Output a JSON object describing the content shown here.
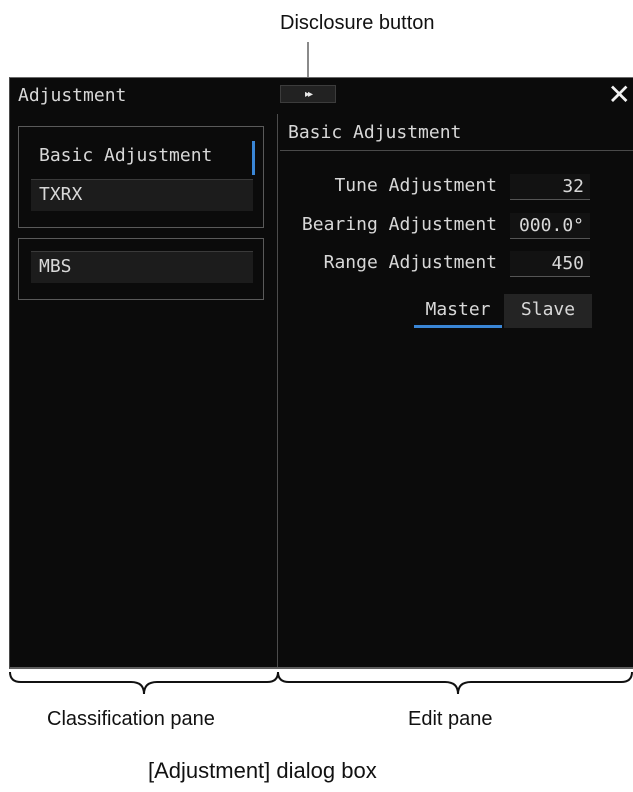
{
  "annotations": {
    "disclosure_button": "Disclosure button",
    "classification_pane": "Classification pane",
    "edit_pane": "Edit pane",
    "figure_caption": "[Adjustment] dialog box"
  },
  "dialog": {
    "title": "Adjustment",
    "disclosure_glyph": "▸▸",
    "close_glyph": "✕",
    "classification": {
      "groups": [
        [
          {
            "label": "Basic Adjustment",
            "selected": true
          },
          {
            "label": "TXRX",
            "selected": false
          }
        ],
        [
          {
            "label": "MBS",
            "selected": false
          }
        ]
      ]
    },
    "edit": {
      "title": "Basic Adjustment",
      "rows": [
        {
          "label": "Tune Adjustment",
          "value": "32"
        },
        {
          "label": "Bearing Adjustment",
          "value": "000.0°"
        },
        {
          "label": "Range Adjustment",
          "value": "450"
        }
      ],
      "mode_options": [
        "Master",
        "Slave"
      ],
      "selected_mode": "Master"
    }
  },
  "colors": {
    "dialog_bg": "#0b0b0b",
    "accent": "#3a86d6",
    "text": "#d8d8d8"
  }
}
